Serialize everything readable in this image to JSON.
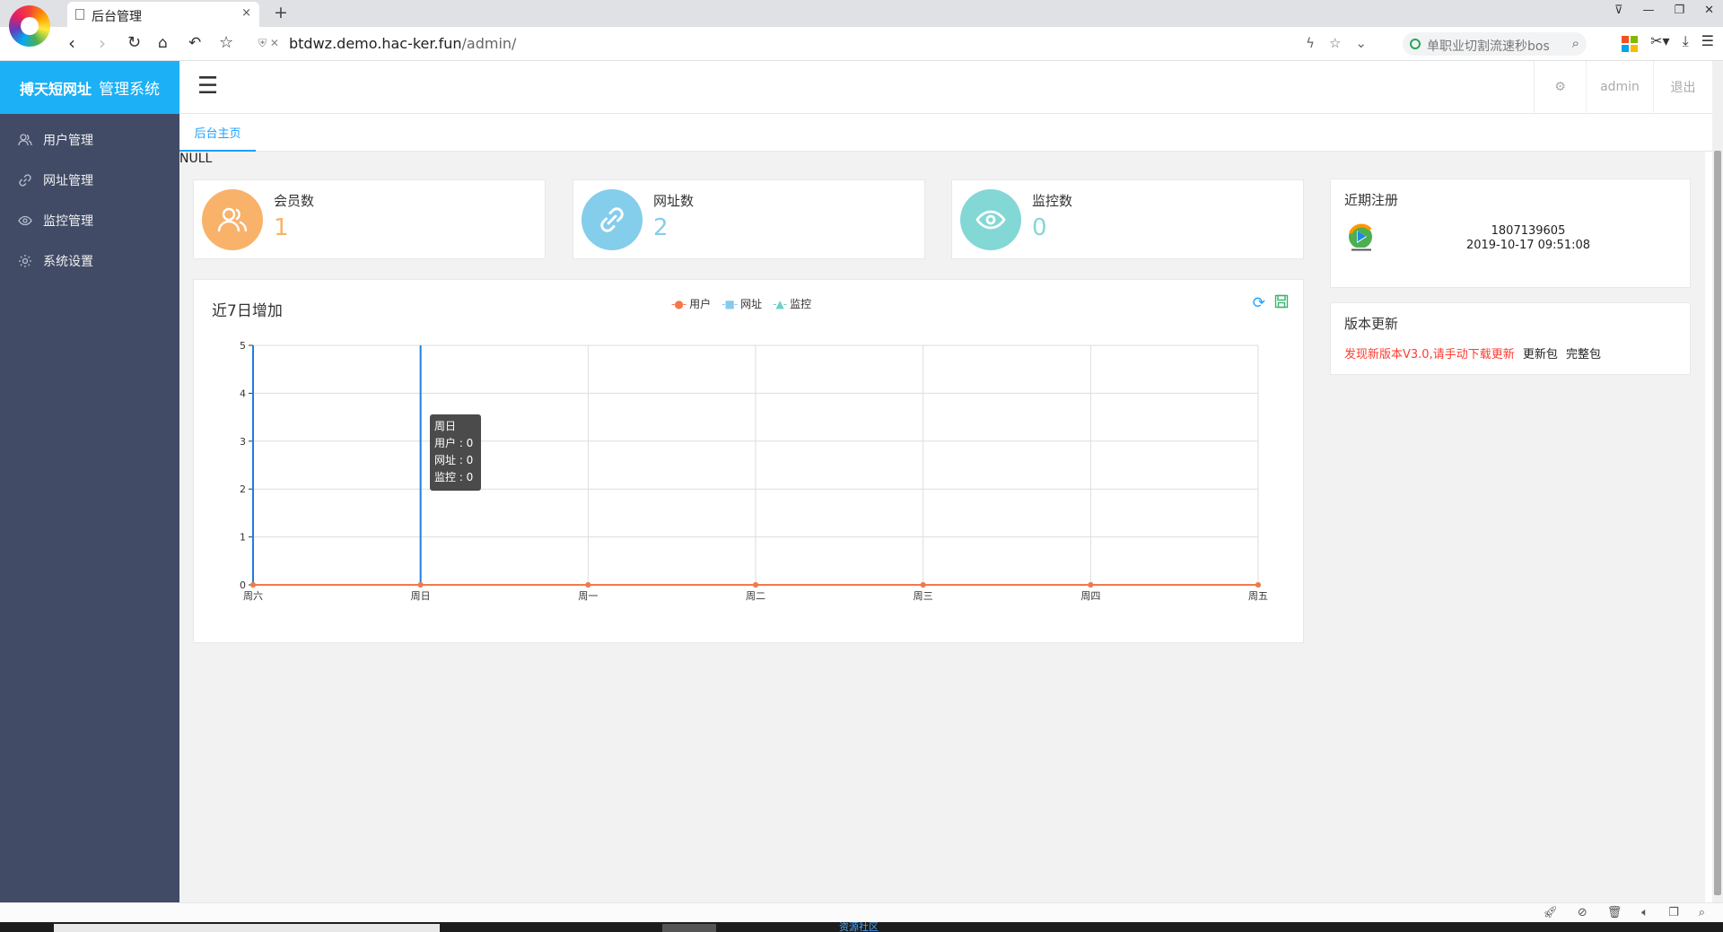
{
  "browser": {
    "tab_title": "后台管理",
    "tab_close": "×",
    "new_tab": "+",
    "url_host": "btdwz.demo.hac-ker.fun",
    "url_path": "/admin/",
    "search_text": "单职业切割流速秒bos",
    "window_buttons": [
      "⊽",
      "—",
      "❐",
      "✕"
    ]
  },
  "app": {
    "logo_bold": "搏天短网址",
    "logo_rest": "管理系统"
  },
  "sidebar": {
    "items": [
      {
        "label": "用户管理",
        "icon": "users-icon"
      },
      {
        "label": "网址管理",
        "icon": "link-icon"
      },
      {
        "label": "监控管理",
        "icon": "eye-icon"
      },
      {
        "label": "系统设置",
        "icon": "gear-icon"
      }
    ]
  },
  "header": {
    "hamburger": "☰",
    "settings_icon": "⚙",
    "user": "admin",
    "logout": "退出"
  },
  "tabs": {
    "home": "后台主页"
  },
  "content": {
    "null_text": "NULL"
  },
  "stats": [
    {
      "label": "会员数",
      "value": "1",
      "color": "#f8b26a",
      "icon": "users-icon"
    },
    {
      "label": "网址数",
      "value": "2",
      "color": "#84cdeb",
      "icon": "link-icon"
    },
    {
      "label": "监控数",
      "value": "0",
      "color": "#83d8d6",
      "icon": "eye-icon"
    }
  ],
  "chart": {
    "title": "近7日增加",
    "tooltip": {
      "title": "周日",
      "lines": [
        "用户 : 0",
        "网址 : 0",
        "监控 : 0"
      ]
    }
  },
  "chart_data": {
    "type": "line",
    "categories": [
      "周六",
      "周日",
      "周一",
      "周二",
      "周三",
      "周四",
      "周五"
    ],
    "series": [
      {
        "name": "用户",
        "values": [
          0,
          0,
          0,
          0,
          0,
          0,
          0
        ],
        "color": "#f4784a"
      },
      {
        "name": "网址",
        "values": [
          0,
          0,
          0,
          0,
          0,
          0,
          0
        ],
        "color": "#87c9ec"
      },
      {
        "name": "监控",
        "values": [
          0,
          0,
          0,
          0,
          0,
          0,
          0
        ],
        "color": "#6dd0c8"
      }
    ],
    "ylim": [
      0,
      5
    ],
    "yticks": [
      0,
      1,
      2,
      3,
      4,
      5
    ],
    "grid": true,
    "legend": "top-center",
    "highlighted_category": "周日"
  },
  "recent": {
    "title": "近期注册",
    "phone": "1807139605",
    "time": "2019-10-17 09:51:08"
  },
  "update": {
    "title": "版本更新",
    "notice": "发现新版本V3.0,请手动下载更新",
    "link1": "更新包",
    "link2": "完整包"
  },
  "taskbar": {
    "text": "资源社区"
  }
}
